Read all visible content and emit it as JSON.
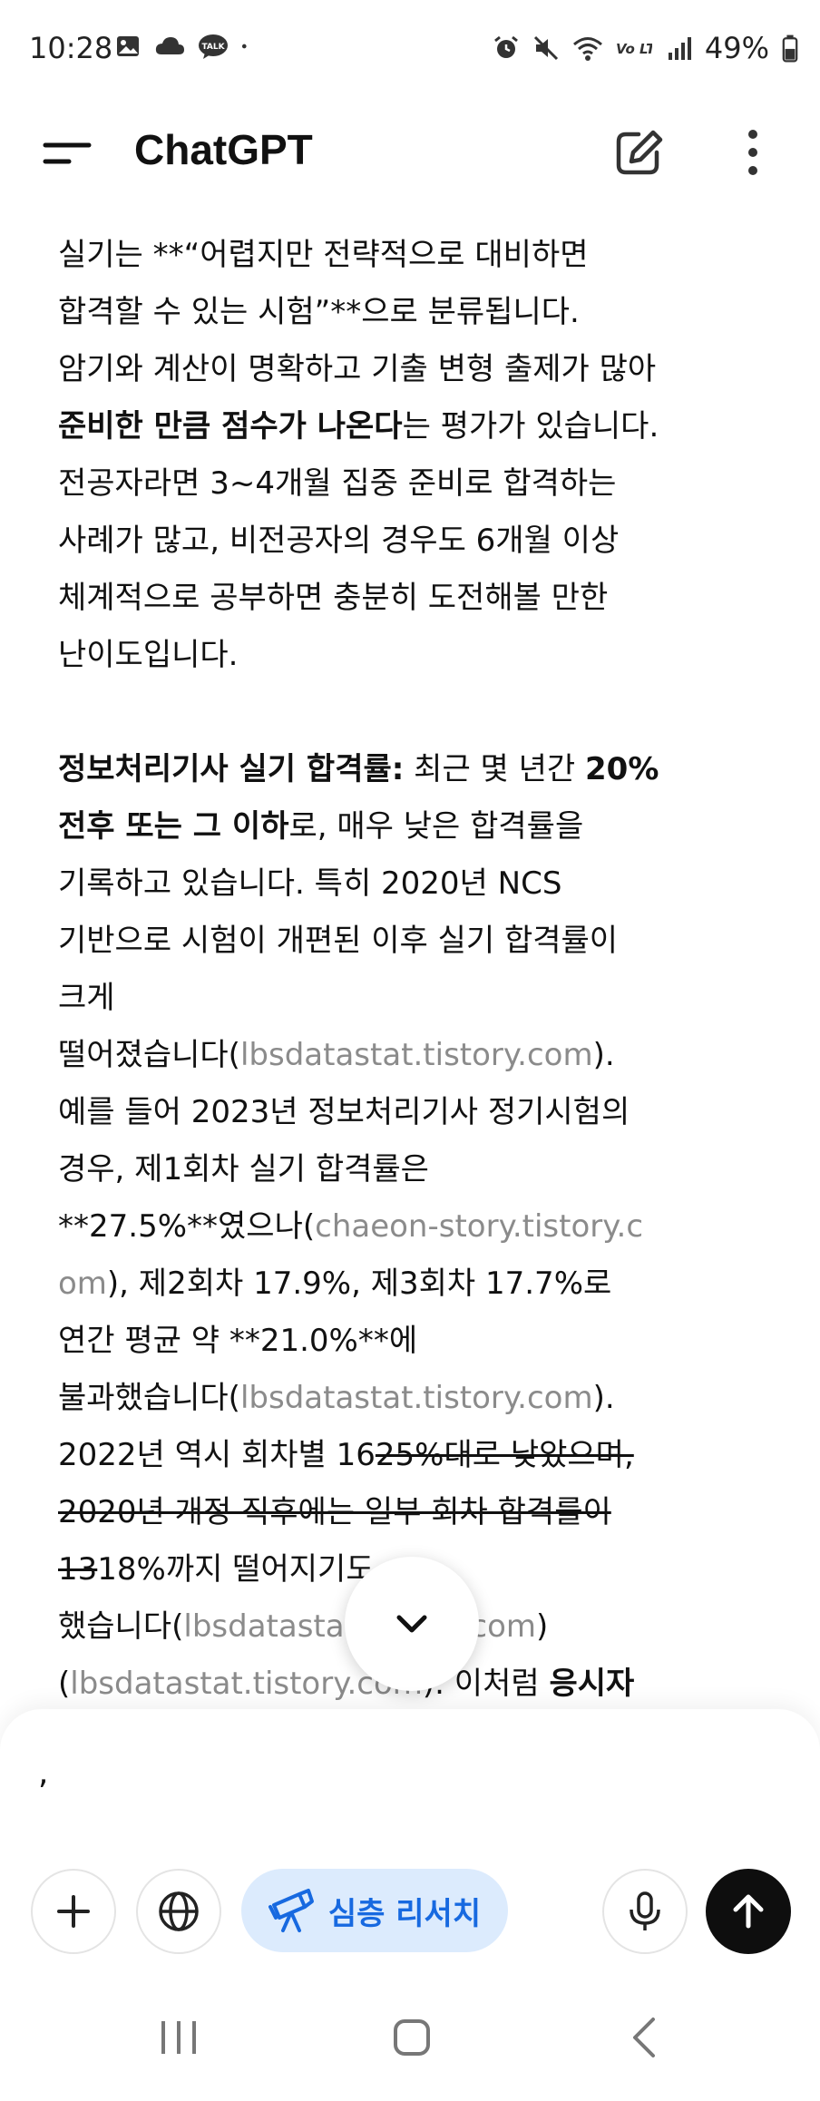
{
  "status_bar": {
    "time": "10:28",
    "left_icons": [
      "gallery-icon",
      "cloud-icon",
      "talk-icon",
      "dot-icon"
    ],
    "right_icons": [
      "alarm-icon",
      "mute-icon",
      "wifi-icon",
      "volte-icon",
      "signal-icon",
      "battery-icon"
    ],
    "talk_badge": "TALK",
    "volte_label": "Vo LTE",
    "battery": "49%"
  },
  "header": {
    "title": "ChatGPT",
    "icons": [
      "menu-icon",
      "new-chat-icon",
      "more-vertical-icon"
    ]
  },
  "message": {
    "para1_lines": [
      "실기는 **“어렵지만 전략적으로 대비하면",
      "합격할 수 있는 시험”**으로 분류됩니다."
    ],
    "para1_line3": "암기와 계산이 명확하고 기출 변형 출제가 많아",
    "para1_bold": "준비한 만큼 점수가 나온다",
    "para1_after_bold": "는 평가가 있습니다.",
    "para1_rest": [
      "전공자라면 3~4개월 집중 준비로 합격하는",
      "사례가 많고, 비전공자의 경우도 6개월 이상",
      "체계적으로 공부하면 충분히 도전해볼 만한",
      "난이도입니다."
    ],
    "para2_head_bold": "정보처리기사 실기 합격률:",
    "para2_head_text": " 최근 몇 년간 ",
    "para2_head_bold2": "20%",
    "para2_line2_bold": "전후 또는 그 이하",
    "para2_line2_text": "로, 매우 낮은 합격률을",
    "para2_lines": [
      "기록하고 있습니다. 특히 2020년 NCS",
      "기반으로 시험이 개편된 이후 실기 합격률이",
      "크게"
    ],
    "para2_line6_text": "떨어졌습니다(",
    "source1": "lbsdatastat.tistory.com",
    "close_paren": ").",
    "para2_line7": "예를 들어 2023년 정보처리기사 정기시험의",
    "para2_line8": "경우, 제1회차 실기 합격률은",
    "para2_line9_text": "**27.5%**였으나(",
    "source2_a": "chaeon-story.tistory.c",
    "source2_b": "om",
    "para2_line10_text": "), 제2회차 17.9%, 제3회차 17.7%로",
    "para2_line11": "연간 평균 약 **21.0%**에",
    "para2_line12_text": "불과했습니다(",
    "source3": "lbsdatastat.tistory.com",
    "para2_line13_pre": "2022년 역시 회차별 16",
    "para2_line13_strike": "25%대로 낮았으며,",
    "para2_line14_strike": "2020년 개정 직후에는 일부 회차 합격률이",
    "para2_line15_strike": "13",
    "para2_line15_text": "18%까지 떨어지기도",
    "para2_line16_text": "했습니다(",
    "source4": "lbsdatastat.tistory.com",
    "para2_line16_close": ")",
    "para2_line17_open": "(",
    "source5": "lbsdatastat.tistory.com",
    "para2_line17_text": "). 이처럼 ",
    "para2_line17_bold": "응시자"
  },
  "composer": {
    "input_value": ",",
    "research_label": "심층 리서치",
    "icons": [
      "plus-icon",
      "globe-icon",
      "telescope-icon",
      "mic-icon",
      "arrow-up-icon"
    ]
  },
  "nav_bar": {
    "icons": [
      "recents-icon",
      "home-icon",
      "back-icon"
    ]
  },
  "colors": {
    "source_link": "#8b8b8b",
    "research_chip_bg": "#dcebfd",
    "research_chip_text": "#1769e0",
    "send_button_bg": "#0e0e0e"
  }
}
